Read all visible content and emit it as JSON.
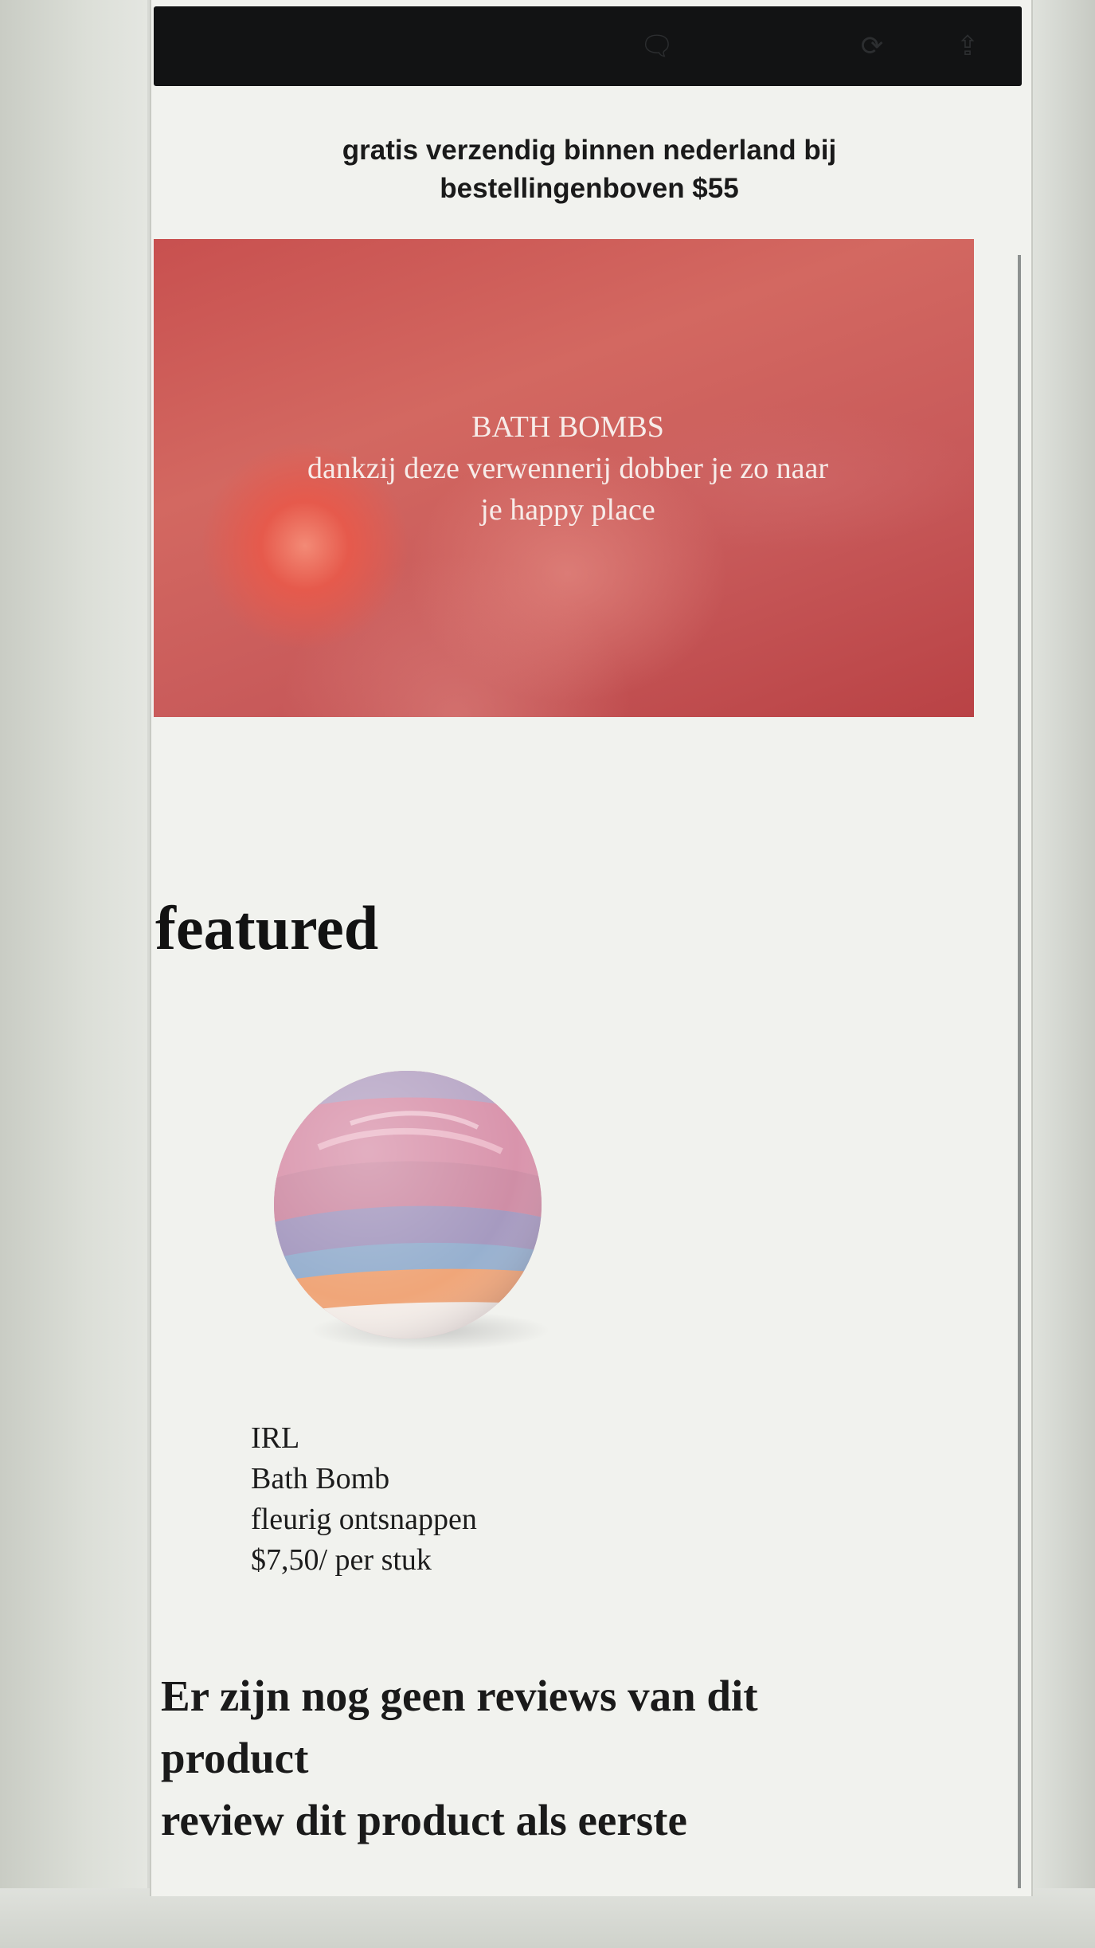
{
  "status_bar": {
    "icons": [
      "chat-icon",
      "sync-icon",
      "share-icon"
    ]
  },
  "shipping_banner": {
    "line1": "gratis verzendig binnen nederland bij",
    "line2": "bestellingenboven $55"
  },
  "hero": {
    "title": "BATH BOMBS",
    "subtitle_line1": "dankzij deze verwennerij dobber je zo naar",
    "subtitle_line2": "je happy place"
  },
  "featured": {
    "heading": "featured",
    "product": {
      "brand": "IRL",
      "name": "Bath Bomb",
      "variant": "fleurig ontsnappen",
      "price": "$7,50/ per stuk"
    }
  },
  "reviews": {
    "line1": "Er zijn nog geen reviews van dit",
    "line2": "product",
    "line3": "review dit product als eerste"
  },
  "colors": {
    "hero_red": "#c8504f",
    "status_bar": "#121314",
    "page_background": "#f1f2ee"
  }
}
